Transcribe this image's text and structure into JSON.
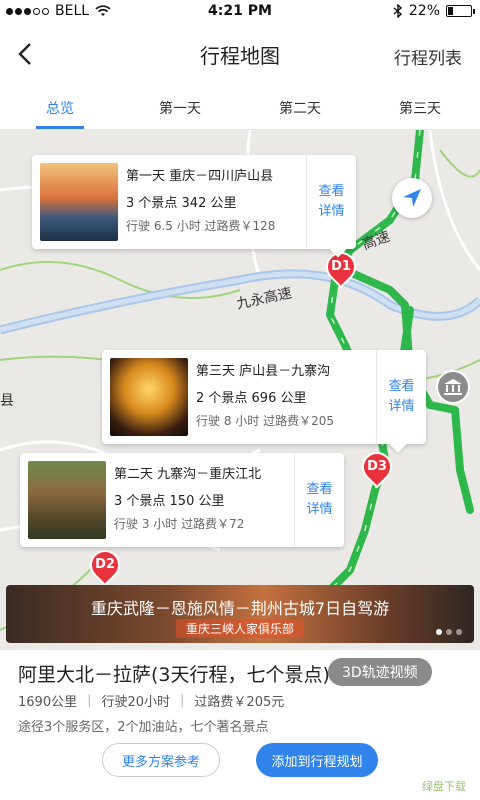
{
  "status_bar": {
    "carrier": "BELL",
    "time": "4:21 PM",
    "battery": "22%"
  },
  "nav": {
    "title": "行程地图",
    "right_label": "行程列表"
  },
  "tabs": [
    {
      "label": "总览",
      "active": true
    },
    {
      "label": "第一天",
      "active": false
    },
    {
      "label": "第二天",
      "active": false
    },
    {
      "label": "第三天",
      "active": false
    }
  ],
  "map": {
    "road_labels": [
      "九永高速",
      "高速"
    ],
    "markers": [
      "D1",
      "D2",
      "D3"
    ],
    "side_label": "县",
    "cards": [
      {
        "title": "第一天 重庆－四川庐山县",
        "spots": "3 个景点  342 公里",
        "drive": "行驶 6.5 小时  过路费￥128",
        "more_1": "查看",
        "more_2": "详情"
      },
      {
        "title": "第三天 庐山县－九寨沟",
        "spots": "2 个景点  696 公里",
        "drive": "行驶 8 小时  过路费￥205",
        "more_1": "查看",
        "more_2": "详情"
      },
      {
        "title": "第二天 九寨沟－重庆江北",
        "spots": "3 个景点  150 公里",
        "drive": "行驶 3 小时  过路费￥72",
        "more_1": "查看",
        "more_2": "详情"
      }
    ]
  },
  "banner": {
    "title": "重庆武隆－恩施风情－荆州古城7日自驾游",
    "subtitle": "重庆三峡人家俱乐部"
  },
  "panel": {
    "route": "阿里大北－拉萨(3天行程，七个景点)",
    "badge": "3D轨迹视频",
    "distance": "1690公里",
    "drive": "行驶20小时",
    "toll": "过路费￥205元",
    "via": "途径3个服务区，2个加油站，七个著名景点",
    "btn_more": "更多方案参考",
    "btn_add": "添加到行程规划"
  },
  "watermark": "绿盘下载",
  "colors": {
    "accent": "#2f83ea",
    "route": "#2eb84b",
    "marker": "#e8323c"
  }
}
